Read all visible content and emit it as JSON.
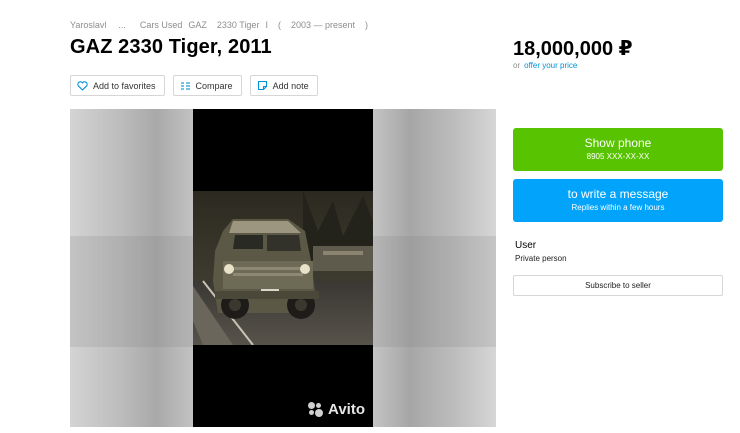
{
  "breadcrumb": {
    "city": "Yaroslavl",
    "ellipsis": "...",
    "category": "Cars Used",
    "brand": "GAZ",
    "model": "2330 Tiger",
    "generation": "I",
    "open_paren": "(",
    "years": "2003 — present",
    "close_paren": ")"
  },
  "listing": {
    "title": "GAZ 2330 Tiger, 2011",
    "price": "18,000,000 ₽",
    "price_or": "or",
    "offer_link": "offer your price"
  },
  "actions": {
    "favorites": "Add to favorites",
    "compare": "Compare",
    "note": "Add note"
  },
  "gallery": {
    "watermark": "Avito"
  },
  "contact": {
    "show_phone": "Show phone",
    "phone_masked": "8905 XXX-XX-XX",
    "write_message": "to write a message",
    "reply_time": "Replies within a few hours"
  },
  "seller": {
    "name": "User",
    "type": "Private person",
    "subscribe": "Subscribe to seller"
  },
  "colors": {
    "phone_button": "#58c300",
    "message_button": "#02a4fb",
    "link": "#0091d9"
  }
}
